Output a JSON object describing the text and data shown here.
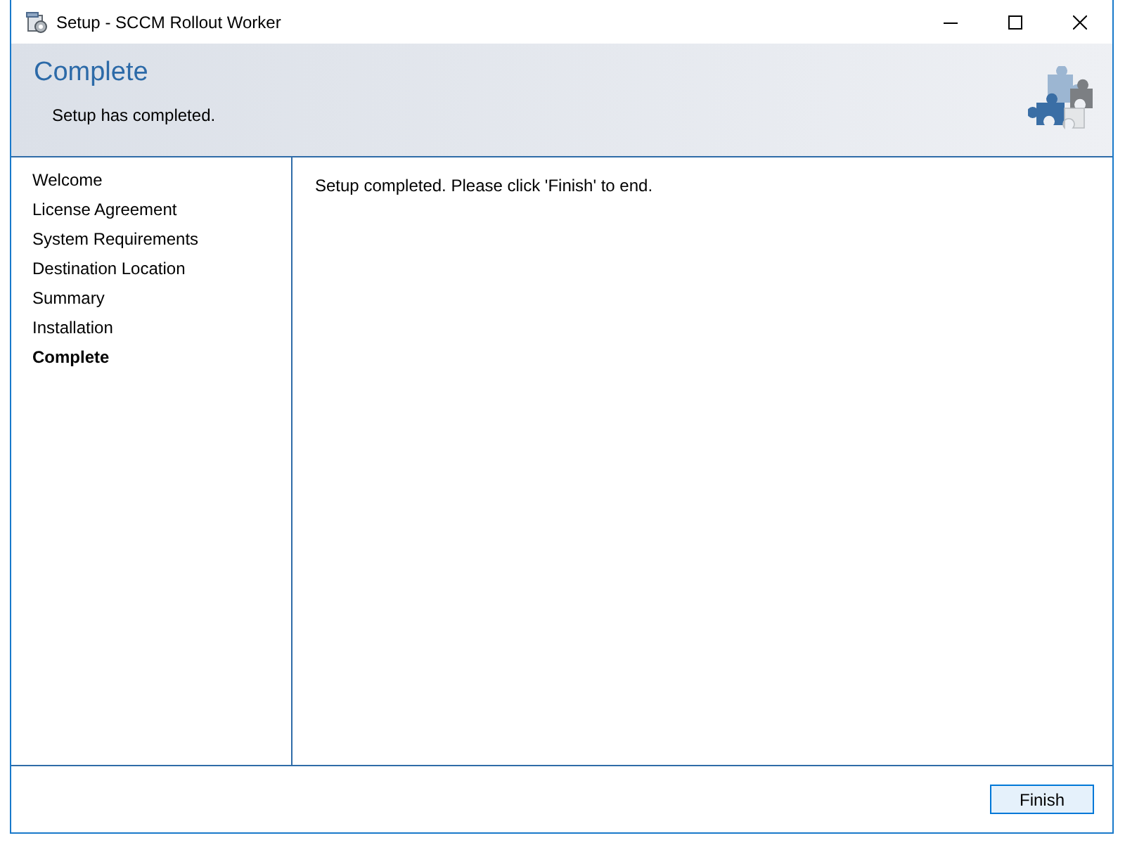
{
  "window": {
    "title": "Setup - SCCM Rollout Worker"
  },
  "header": {
    "title": "Complete",
    "subtitle": "Setup has completed."
  },
  "sidebar": {
    "items": [
      {
        "label": "Welcome",
        "selected": false
      },
      {
        "label": "License Agreement",
        "selected": false
      },
      {
        "label": "System Requirements",
        "selected": false
      },
      {
        "label": "Destination Location",
        "selected": false
      },
      {
        "label": "Summary",
        "selected": false
      },
      {
        "label": "Installation",
        "selected": false
      },
      {
        "label": "Complete",
        "selected": true
      }
    ]
  },
  "content": {
    "message": "Setup completed. Please click 'Finish' to end."
  },
  "buttons": [
    {
      "label": "Finish"
    }
  ]
}
